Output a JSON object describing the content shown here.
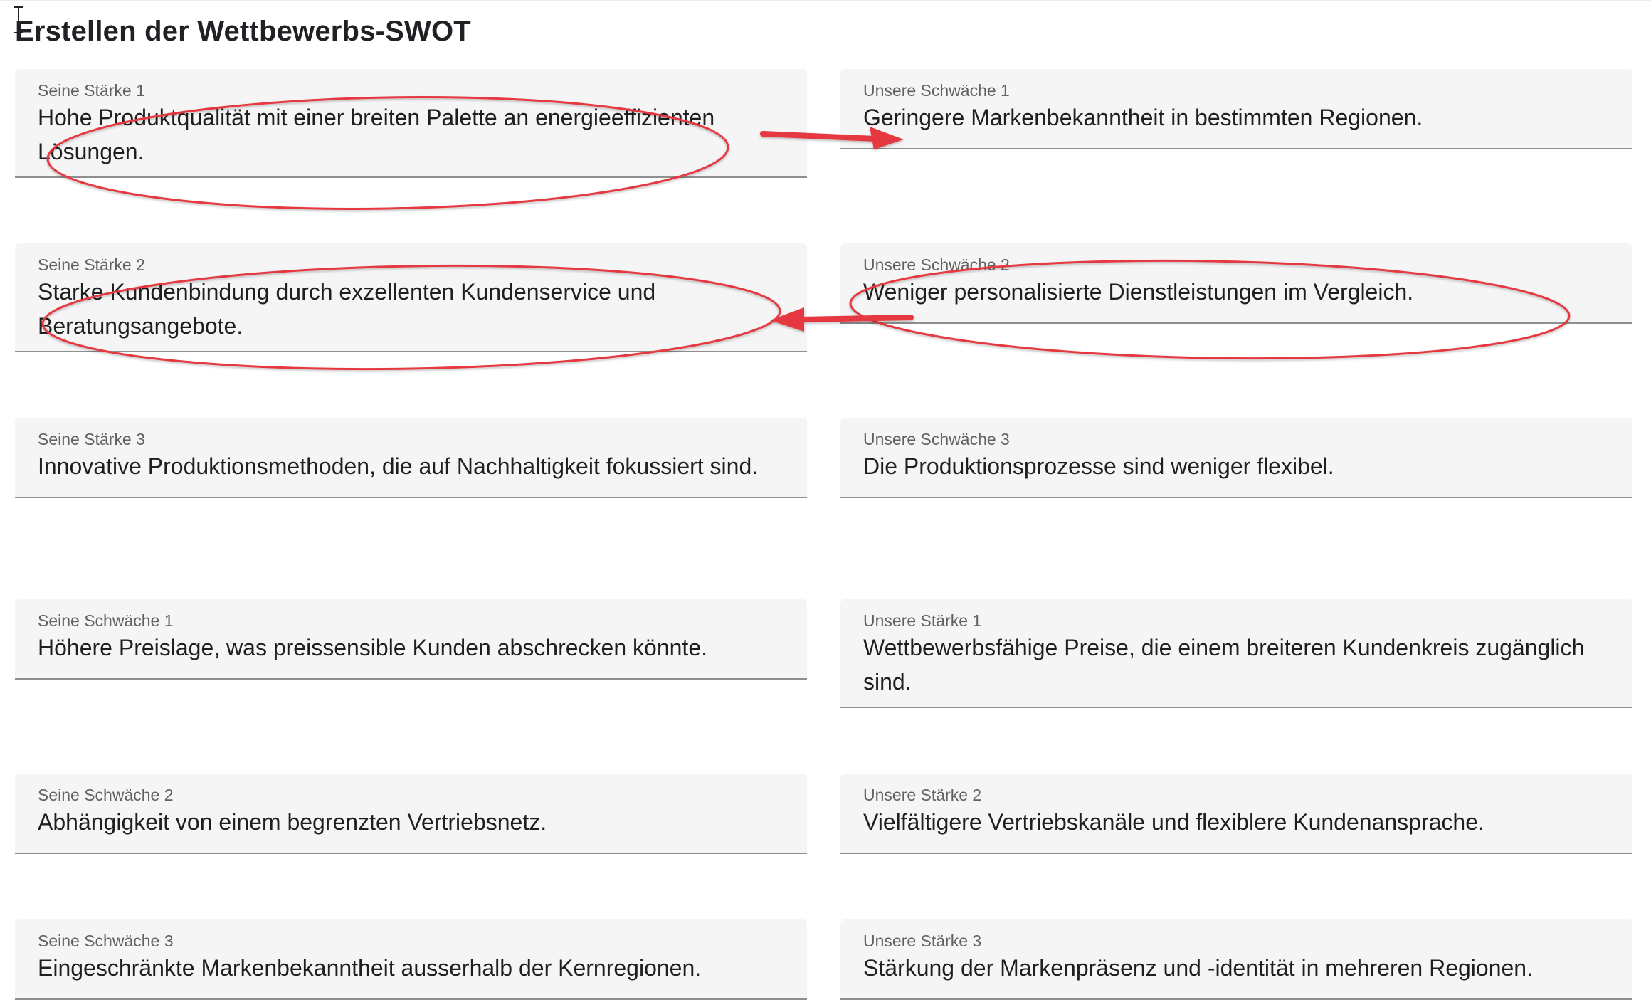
{
  "page": {
    "title": "Erstellen der Wettbewerbs-SWOT"
  },
  "competitor_strengths": [
    {
      "label": "Seine Stärke 1",
      "value": "Hohe Produktqualität mit einer breiten Palette an energieeffizienten Lösungen."
    },
    {
      "label": "Seine Stärke 2",
      "value": "Starke Kundenbindung durch exzellenten Kundenservice und Beratungsangebote."
    },
    {
      "label": "Seine Stärke 3",
      "value": "Innovative Produktionsmethoden, die auf Nachhaltigkeit fokussiert sind."
    }
  ],
  "our_weaknesses": [
    {
      "label": "Unsere Schwäche 1",
      "value": "Geringere Markenbekanntheit in bestimmten Regionen."
    },
    {
      "label": "Unsere Schwäche 2",
      "value": "Weniger personalisierte Dienstleistungen im Vergleich."
    },
    {
      "label": "Unsere Schwäche 3",
      "value": "Die Produktionsprozesse sind weniger flexibel."
    }
  ],
  "competitor_weaknesses": [
    {
      "label": "Seine Schwäche 1",
      "value": "Höhere Preislage, was preissensible Kunden abschrecken könnte."
    },
    {
      "label": "Seine Schwäche 2",
      "value": "Abhängigkeit von einem begrenzten Vertriebsnetz."
    },
    {
      "label": "Seine Schwäche 3",
      "value": "Eingeschränkte Markenbekanntheit ausserhalb der Kernregionen."
    }
  ],
  "our_strengths": [
    {
      "label": "Unsere Stärke 1",
      "value": "Wettbewerbsfähige Preise, die einem breiteren Kundenkreis zugänglich sind."
    },
    {
      "label": "Unsere Stärke 2",
      "value": "Vielfältigere Vertriebskanäle und flexiblere Kundenansprache."
    },
    {
      "label": "Unsere Stärke 3",
      "value": "Stärkung der Markenpräsenz und -identität in mehreren Regionen."
    }
  ],
  "colors": {
    "annotation": "#e5393f",
    "field_background": "#f5f5f5",
    "field_underline": "#8f8f8f"
  }
}
